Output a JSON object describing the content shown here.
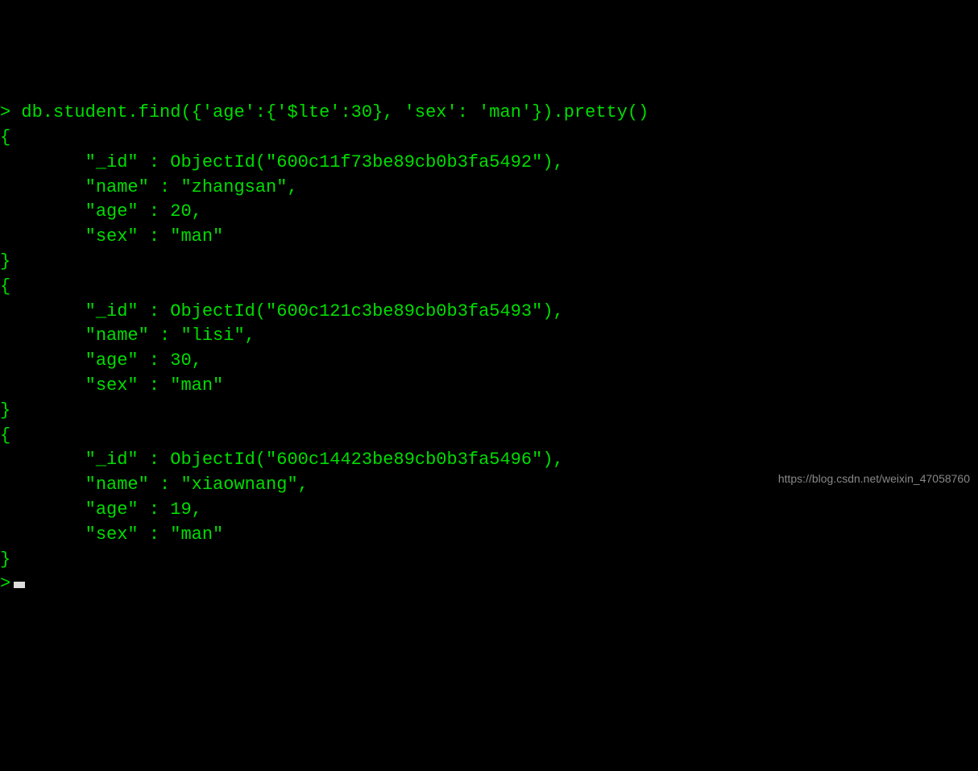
{
  "prompt_char": ">",
  "command": "db.student.find({'age':{'$lte':30}, 'sex': 'man'}).pretty()",
  "open_brace": "{",
  "close_brace": "}",
  "indent": "        ",
  "results": [
    {
      "id_line": "\"_id\" : ObjectId(\"600c11f73be89cb0b3fa5492\"),",
      "name_line": "\"name\" : \"zhangsan\",",
      "age_line": "\"age\" : 20,",
      "sex_line": "\"sex\" : \"man\""
    },
    {
      "id_line": "\"_id\" : ObjectId(\"600c121c3be89cb0b3fa5493\"),",
      "name_line": "\"name\" : \"lisi\",",
      "age_line": "\"age\" : 30,",
      "sex_line": "\"sex\" : \"man\""
    },
    {
      "id_line": "\"_id\" : ObjectId(\"600c14423be89cb0b3fa5496\"),",
      "name_line": "\"name\" : \"xiaownang\",",
      "age_line": "\"age\" : 19,",
      "sex_line": "\"sex\" : \"man\""
    }
  ],
  "watermark": "https://blog.csdn.net/weixin_47058760"
}
